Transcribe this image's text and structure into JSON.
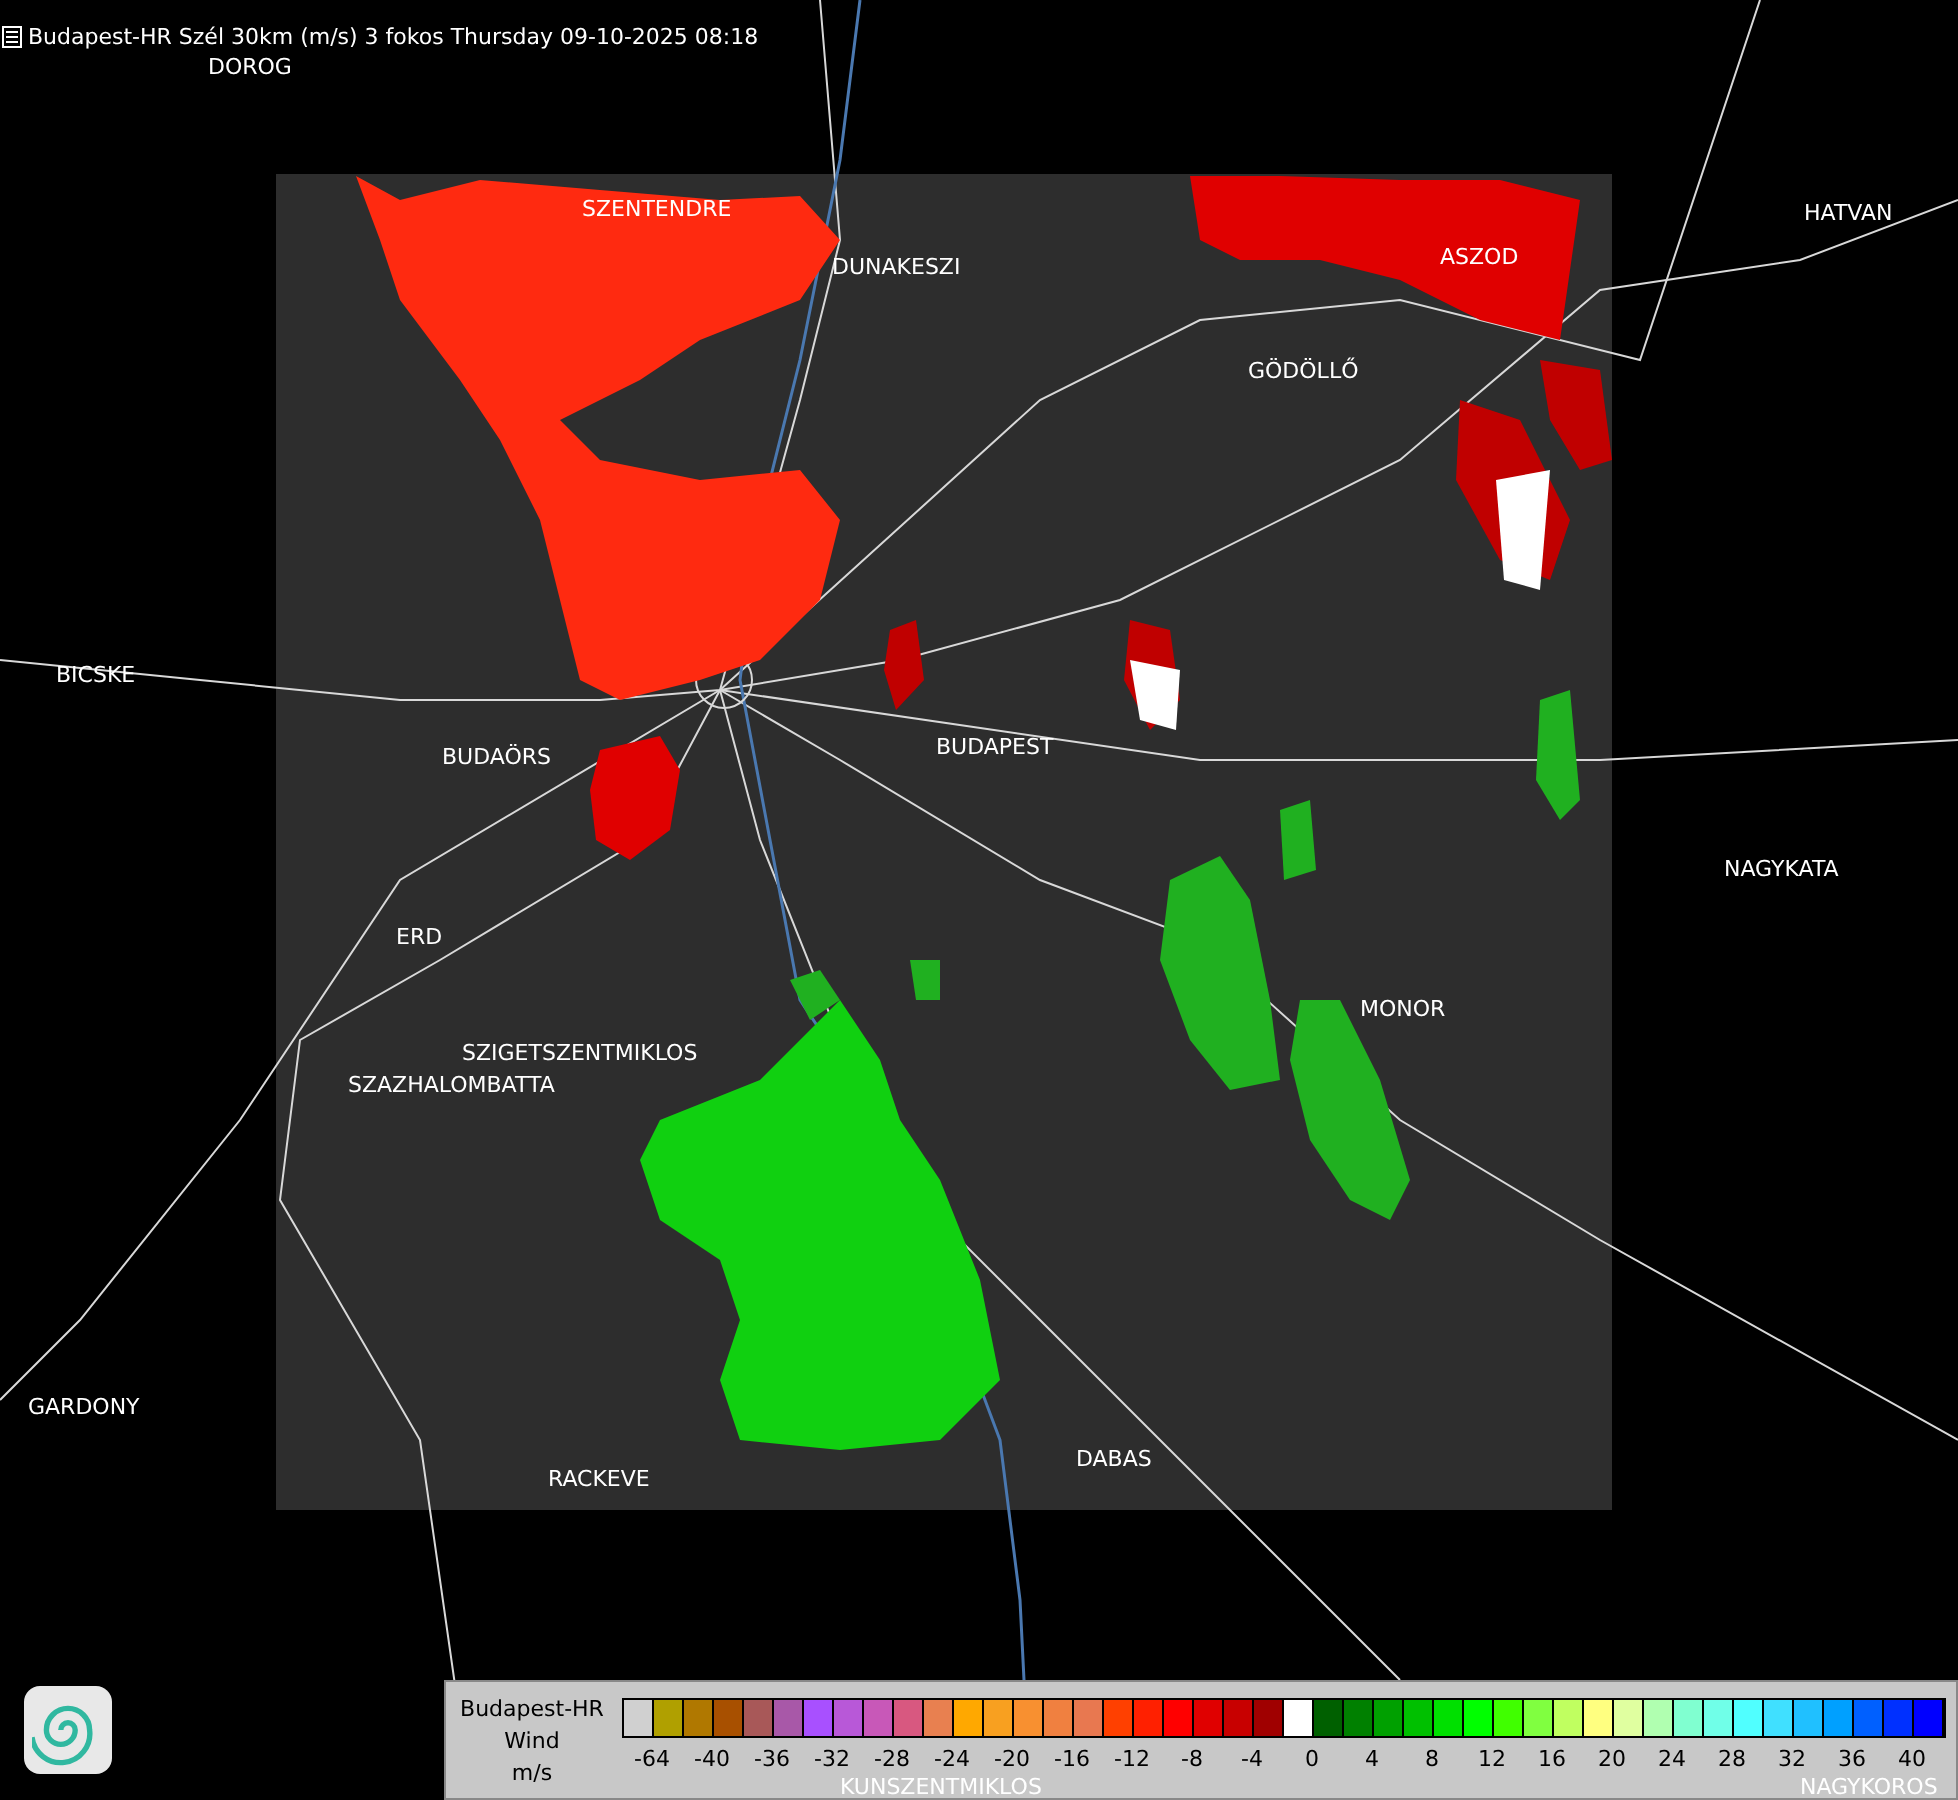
{
  "title": "Budapest-HR Szél 30km (m/s) 3 fokos Thursday 09-10-2025 08:18",
  "map_labels": [
    "DOROG",
    "SZENTENDRE",
    "DUNAKESZI",
    "ASZOD",
    "HATVAN",
    "GÖDÖLLŐ",
    "BICSKE",
    "BUDAÖRS",
    "BUDAPEST",
    "NAGYKATA",
    "ERD",
    "MONOR",
    "SZIGETSZENTMIKLOS",
    "SZAZHALOMBATTA",
    "GARDONY",
    "RACKEVE",
    "DABAS",
    "KUNSZENTMIKLOS",
    "NAGYKOROS"
  ],
  "legend": {
    "lines": [
      "Budapest-HR",
      "Wind",
      "m/s"
    ],
    "swatches": [
      {
        "color": "#d0d0d0"
      },
      {
        "color": "#b0a000"
      },
      {
        "color": "#b07800"
      },
      {
        "color": "#a85000"
      },
      {
        "color": "#a85858"
      },
      {
        "color": "#a858a8"
      },
      {
        "color": "#a850ff"
      },
      {
        "color": "#b858d8"
      },
      {
        "color": "#c858b8"
      },
      {
        "color": "#d85880"
      },
      {
        "color": "#e88050"
      },
      {
        "color": "#ffa800"
      },
      {
        "color": "#f8a020"
      },
      {
        "color": "#f89030"
      },
      {
        "color": "#f08040"
      },
      {
        "color": "#e87850"
      },
      {
        "color": "#ff4000"
      },
      {
        "color": "#ff2000"
      },
      {
        "color": "#ff0000"
      },
      {
        "color": "#e00000"
      },
      {
        "color": "#c80000"
      },
      {
        "color": "#a00000"
      },
      {
        "color": "#ffffff"
      },
      {
        "color": "#006000"
      },
      {
        "color": "#008000"
      },
      {
        "color": "#00a000"
      },
      {
        "color": "#00c000"
      },
      {
        "color": "#00e000"
      },
      {
        "color": "#00ff00"
      },
      {
        "color": "#40ff00"
      },
      {
        "color": "#80ff40"
      },
      {
        "color": "#c0ff60"
      },
      {
        "color": "#ffff80"
      },
      {
        "color": "#e0ffa0"
      },
      {
        "color": "#b0ffb0"
      },
      {
        "color": "#80ffd0"
      },
      {
        "color": "#70ffe8"
      },
      {
        "color": "#50ffff"
      },
      {
        "color": "#40e0ff"
      },
      {
        "color": "#20c0ff"
      },
      {
        "color": "#00a0ff"
      },
      {
        "color": "#0060ff"
      },
      {
        "color": "#0030ff"
      },
      {
        "color": "#0000ff"
      }
    ],
    "labels": [
      "-64",
      "-40",
      "-36",
      "-32",
      "-28",
      "-24",
      "-20",
      "-16",
      "-12",
      "-8",
      "-4",
      "0",
      "4",
      "8",
      "12",
      "16",
      "20",
      "24",
      "28",
      "32",
      "36",
      "40"
    ]
  }
}
